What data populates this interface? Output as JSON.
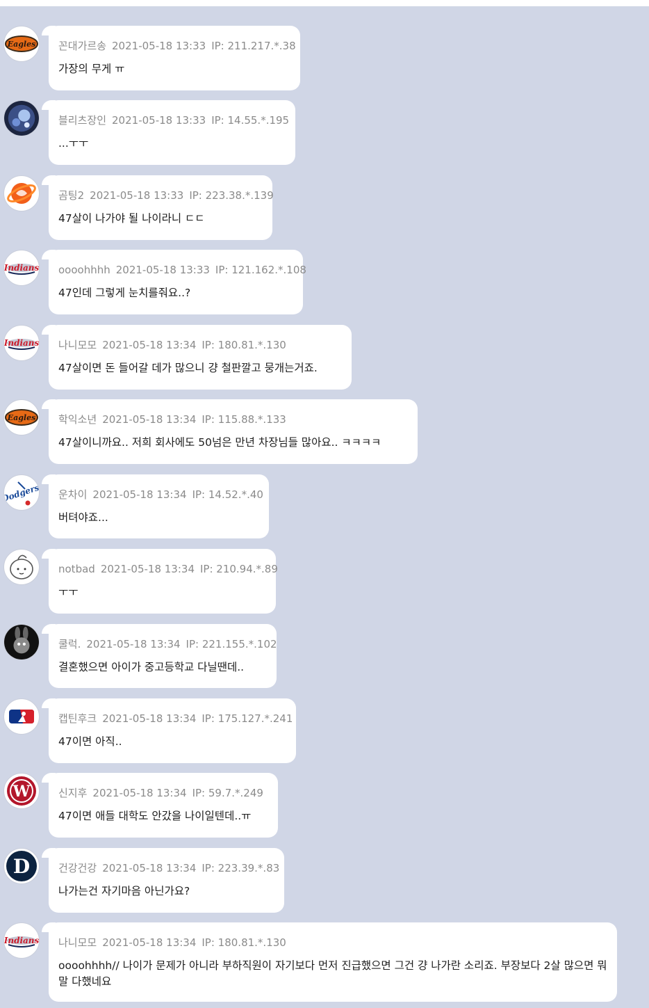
{
  "comments": [
    {
      "author": "꼰대가르송",
      "date": "2021-05-18 13:33",
      "ip": "IP: 211.217.*.38",
      "text": "가장의 무게 ㅠ",
      "avatar": "eagles-logo-icon"
    },
    {
      "author": "블리츠장인",
      "date": "2021-05-18 13:33",
      "ip": "IP: 14.55.*.195",
      "text": "...ㅜㅜ",
      "avatar": "dark-creature-avatar-icon"
    },
    {
      "author": "곰팅2",
      "date": "2021-05-18 13:33",
      "ip": "IP: 223.38.*.139",
      "text": "47살이 나가야 될 나이라니 ㄷㄷ",
      "avatar": "orange-ball-logo-icon"
    },
    {
      "author": "oooohhhh",
      "date": "2021-05-18 13:33",
      "ip": "IP: 121.162.*.108",
      "text": "47인데 그렇게 눈치를줘요..?",
      "avatar": "indians-logo-icon"
    },
    {
      "author": "나니모모",
      "date": "2021-05-18 13:34",
      "ip": "IP: 180.81.*.130",
      "text": "47살이면 돈 들어갈 데가 많으니 걍 철판깔고 뭉개는거죠.",
      "avatar": "indians-logo-icon"
    },
    {
      "author": "학익소년",
      "date": "2021-05-18 13:34",
      "ip": "IP: 115.88.*.133",
      "text": "47살이니까요.. 저희 회사에도 50넘은 만년 차장님들 많아요.. ㅋㅋㅋㅋ",
      "avatar": "eagles-logo-icon"
    },
    {
      "author": "운차이",
      "date": "2021-05-18 13:34",
      "ip": "IP: 14.52.*.40",
      "text": "버텨야죠...",
      "avatar": "dodgers-logo-icon"
    },
    {
      "author": "notbad",
      "date": "2021-05-18 13:34",
      "ip": "IP: 210.94.*.89",
      "text": "ㅜㅜ",
      "avatar": "doodle-face-avatar-icon"
    },
    {
      "author": "쿨럭.",
      "date": "2021-05-18 13:34",
      "ip": "IP: 221.155.*.102",
      "text": "결혼했으면 아이가 중고등학교 다닐땐데..",
      "avatar": "bunny-avatar-icon"
    },
    {
      "author": "캡틴후크",
      "date": "2021-05-18 13:34",
      "ip": "IP: 175.127.*.241",
      "text": "47이면 아직..",
      "avatar": "mlb-logo-icon"
    },
    {
      "author": "신지후",
      "date": "2021-05-18 13:34",
      "ip": "IP: 59.7.*.249",
      "text": "47이면 애들 대학도 안갔을 나이일텐데..ㅠ",
      "avatar": "nationals-logo-icon"
    },
    {
      "author": "건강건강",
      "date": "2021-05-18 13:34",
      "ip": "IP: 223.39.*.83",
      "text": "나가는건 자기마음 아닌가요?",
      "avatar": "tigers-logo-icon"
    },
    {
      "author": "나니모모",
      "date": "2021-05-18 13:34",
      "ip": "IP: 180.81.*.130",
      "text": "oooohhhh// 나이가 문제가 아니라 부하직원이 자기보다 먼저 진급했으면 그건 걍 나가란 소리죠. 부장보다 2살 많으면 뭐 말 다했네요",
      "avatar": "indians-logo-icon"
    }
  ],
  "colors": {
    "page_bg": "#d0d6e6",
    "bubble_bg": "#ffffff",
    "meta_text": "#8b8b8b",
    "body_text": "#1d1d1d"
  }
}
